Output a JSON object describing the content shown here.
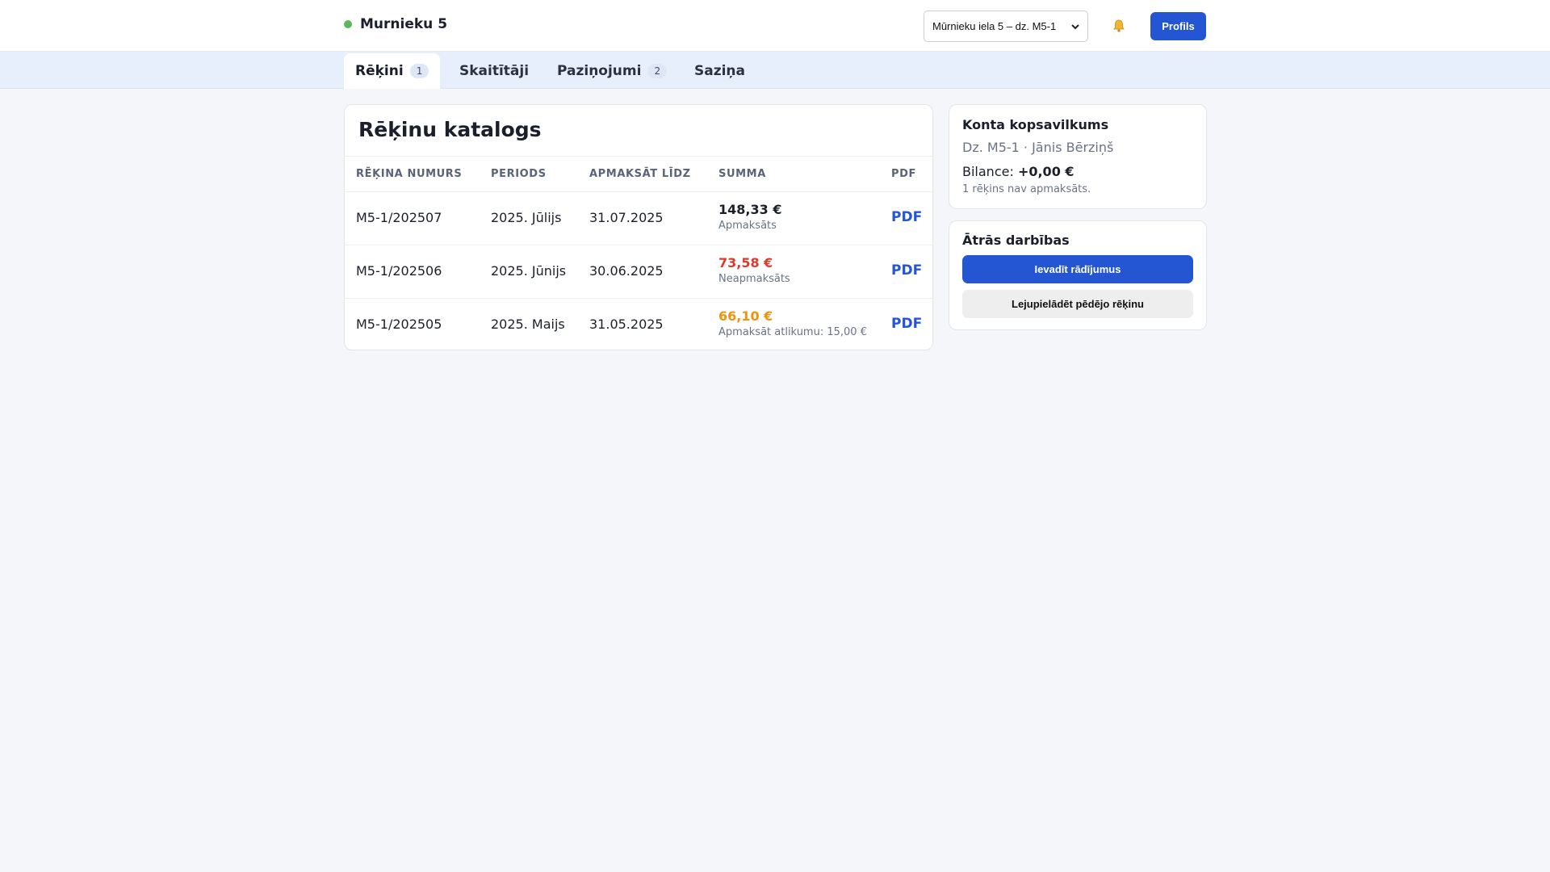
{
  "brand": {
    "name": "Murnieku 5",
    "status_color": "#5cb85c"
  },
  "header": {
    "apartment_select": "Mūrnieku iela 5 – dz. M5-1",
    "bell_icon": "bell-icon",
    "profile_label": "Profils"
  },
  "tabs": [
    {
      "label": "Rēķini",
      "badge": "1",
      "active": true
    },
    {
      "label": "Skaitītāji",
      "badge": "",
      "active": false
    },
    {
      "label": "Paziņojumi",
      "badge": "2",
      "active": false
    },
    {
      "label": "Saziņa",
      "badge": "",
      "active": false
    }
  ],
  "catalog": {
    "title": "Rēķinu katalogs",
    "columns": [
      "RĒĶINA NUMURS",
      "PERIODS",
      "APMAKSĀT LĪDZ",
      "SUMMA",
      "PDF"
    ],
    "rows": [
      {
        "number": "M5-1/202507",
        "period": "2025. Jūlijs",
        "due": "31.07.2025",
        "amount": "148,33 €",
        "status": "Apmaksāts",
        "amount_color": "#1a1f2b",
        "pdf": "PDF"
      },
      {
        "number": "M5-1/202506",
        "period": "2025. Jūnijs",
        "due": "30.06.2025",
        "amount": "73,58 €",
        "status": "Neapmaksāts",
        "amount_color": "#e0392b",
        "pdf": "PDF"
      },
      {
        "number": "M5-1/202505",
        "period": "2025. Maijs",
        "due": "31.05.2025",
        "amount": "66,10 €",
        "status": "Apmaksāt atlikumu: 15,00 €",
        "amount_color": "#f0930c",
        "pdf": "PDF"
      }
    ]
  },
  "summary": {
    "title": "Konta kopsavilkums",
    "subtitle": "Dz. M5-1 · Jānis Bērziņš",
    "balance_label": "Bilance:",
    "balance_value": "+0,00 €",
    "note": "1 rēķins nav apmaksāts."
  },
  "actions": {
    "title": "Ātrās darbības",
    "primary_label": "Ievadīt rādījumus",
    "secondary_label": "Lejupielādēt pēdējo rēķinu"
  },
  "colors": {
    "accent": "#2456d3",
    "tabbar_bg": "#e8effc",
    "page_bg": "#f4f6fa"
  }
}
